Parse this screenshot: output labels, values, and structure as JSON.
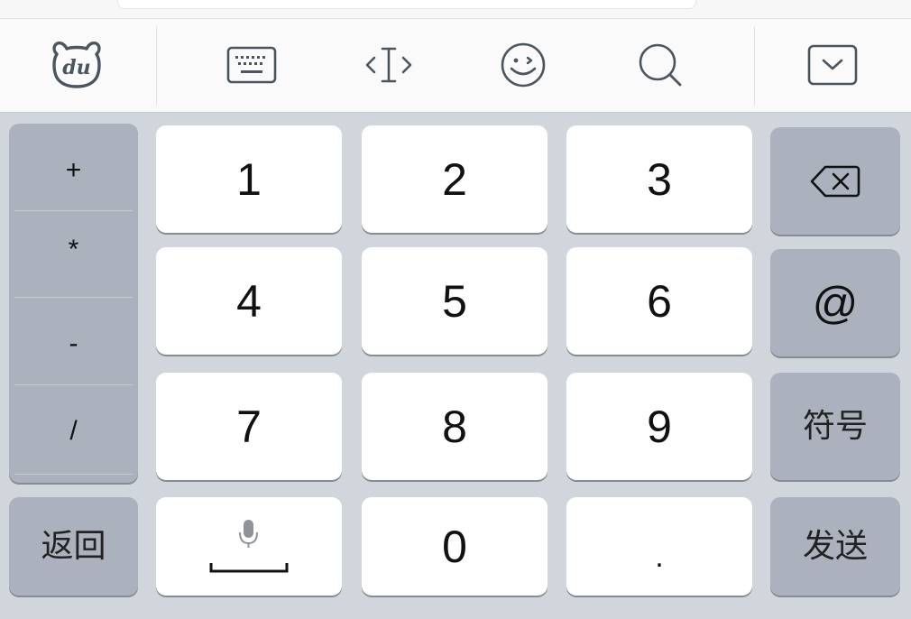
{
  "toolbar": {
    "logo_text": "du",
    "icons": [
      "bear-logo-icon",
      "keyboard-icon",
      "cursor-icon",
      "emoji-icon",
      "search-icon",
      "collapse-icon"
    ]
  },
  "side_symbols": [
    "+",
    "*",
    "-",
    "/"
  ],
  "digits": {
    "row1": [
      "1",
      "2",
      "3"
    ],
    "row2": [
      "4",
      "5",
      "6"
    ],
    "row3": [
      "7",
      "8",
      "9"
    ],
    "zero": "0",
    "dot": "."
  },
  "keys": {
    "at": "@",
    "symbols": "符号",
    "back": "返回",
    "send": "发送"
  },
  "colors": {
    "keyboard_bg": "#d1d5dc",
    "white_key": "#ffffff",
    "gray_key": "#abb1bd",
    "toolbar_bg": "#fafafa",
    "icon_stroke": "#4a5560"
  }
}
